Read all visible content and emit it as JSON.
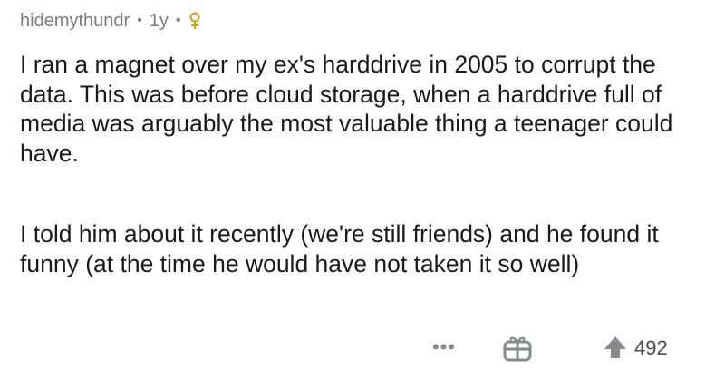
{
  "comment": {
    "username": "hidemythundr",
    "separator": "•",
    "age": "1y",
    "flair_icon": "female-sign-icon",
    "flair_color": "#d4a017",
    "paragraphs": [
      "I ran a magnet over my ex's harddrive in 2005 to corrupt the data. This was before cloud storage, when a harddrive full of media was arguably the most valuable thing a teenager could have.",
      "I told him about it recently (we're still friends) and he found it funny (at the time he would have not taken it so well)"
    ]
  },
  "actions": {
    "more_label": "•••",
    "award_icon": "gift-icon",
    "upvote_icon": "upvote-arrow-icon",
    "score": "492"
  },
  "colors": {
    "text": "#1a1a1b",
    "meta": "#7c7c7c",
    "icon": "#878a8c"
  }
}
